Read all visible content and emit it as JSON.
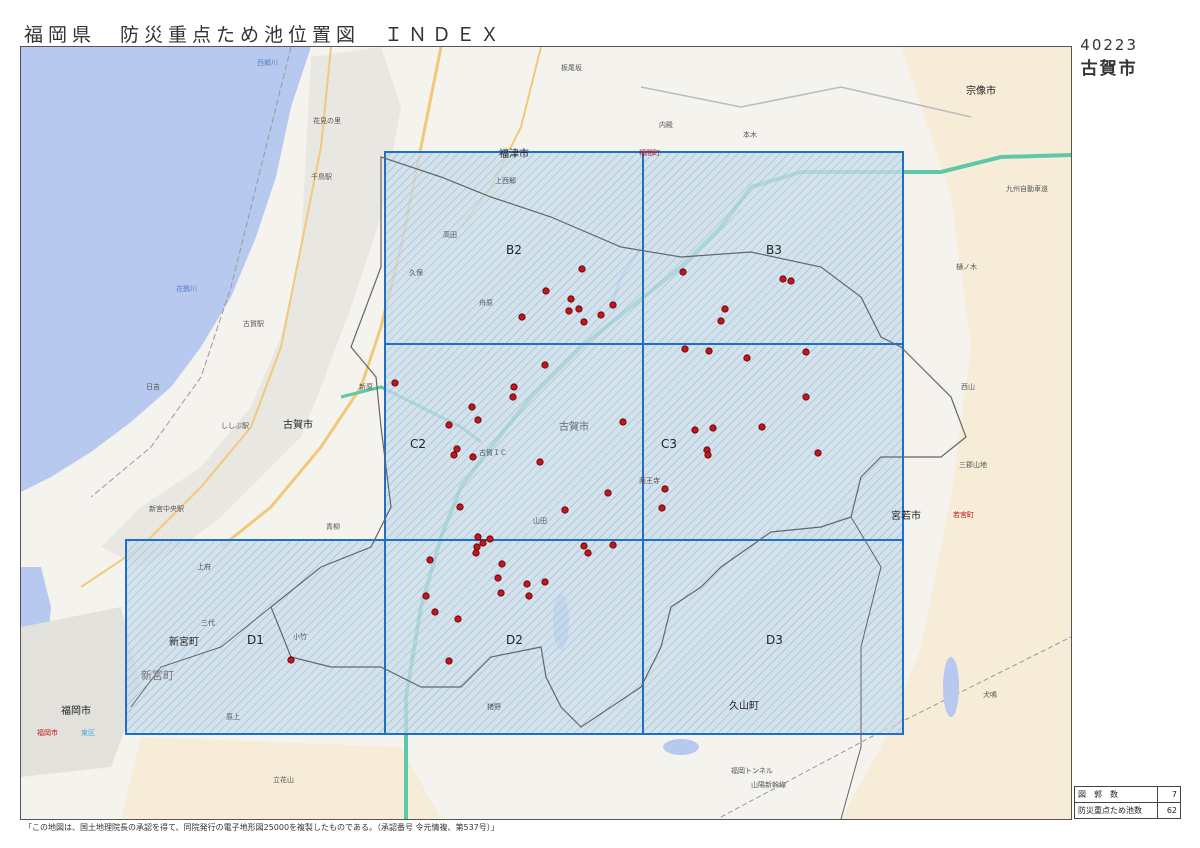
{
  "header": {
    "title": "福岡県　防災重点ため池位置図　ＩＮＤＥＸ",
    "code": "40223",
    "city": "古賀市"
  },
  "map": {
    "place_labels": [
      {
        "id": "fukutsu-city",
        "text": "福津市"
      },
      {
        "id": "koga-city-west",
        "text": "古賀市"
      },
      {
        "id": "koga-city-center",
        "text": "古賀市"
      },
      {
        "id": "miyawaka-city",
        "text": "宮若市"
      },
      {
        "id": "munakata-city",
        "text": "宗像市"
      },
      {
        "id": "shingu-town",
        "text": "新宮町"
      },
      {
        "id": "hisayama-town",
        "text": "久山町"
      },
      {
        "id": "fukuoka-city",
        "text": "福岡市"
      }
    ],
    "feature_labels": [
      {
        "id": "hananosato",
        "text": "花見の里"
      },
      {
        "id": "chidori-station",
        "text": "千鳥駅"
      },
      {
        "id": "koga-station",
        "text": "古賀駅"
      },
      {
        "id": "shishibu-station",
        "text": "ししぶ駅"
      },
      {
        "id": "shingu-chuo-station",
        "text": "新宮中央駅"
      },
      {
        "id": "koga-ic",
        "text": "古賀ＩＣ"
      },
      {
        "id": "kyushu-expressway",
        "text": "九州自動車道"
      },
      {
        "id": "hinoki",
        "text": "樋ノ木"
      },
      {
        "id": "nishiyama",
        "text": "西山"
      },
      {
        "id": "inukujira",
        "text": "犬鳴"
      },
      {
        "id": "tachibana",
        "text": "立花山"
      },
      {
        "id": "fukuoka-tunnel",
        "text": "福岡トンネル"
      },
      {
        "id": "sanyo-shinkansen",
        "text": "山陽新幹線"
      },
      {
        "id": "hibiki",
        "text": "日吉"
      },
      {
        "id": "shinbara",
        "text": "新原"
      },
      {
        "id": "aoyagi",
        "text": "青柳"
      },
      {
        "id": "itabashi",
        "text": "板尾坂"
      },
      {
        "id": "uchitono",
        "text": "内殿"
      },
      {
        "id": "motogi",
        "text": "本木"
      },
      {
        "id": "kubo",
        "text": "久保"
      },
      {
        "id": "takada",
        "text": "高田"
      },
      {
        "id": "kamiyoshida",
        "text": "上西郷"
      },
      {
        "id": "funabara",
        "text": "舟原"
      },
      {
        "id": "yakuoji",
        "text": "薬王寺"
      },
      {
        "id": "mitsuse",
        "text": "三郡山地"
      },
      {
        "id": "wakamiya",
        "text": "若宮町"
      },
      {
        "id": "fukutsu-red",
        "text": "福間町"
      },
      {
        "id": "fukuoka-red",
        "text": "福岡市"
      },
      {
        "id": "kasuya",
        "text": "東区"
      },
      {
        "id": "shingu-big",
        "text": "新宮町"
      },
      {
        "id": "mitoko",
        "text": "三代"
      },
      {
        "id": "kotake",
        "text": "小竹"
      },
      {
        "id": "higashi-kotake",
        "text": "上府"
      },
      {
        "id": "kamibaru",
        "text": "原上"
      },
      {
        "id": "yonekawa",
        "text": "猪野"
      },
      {
        "id": "yamada",
        "text": "山田"
      },
      {
        "id": "fukui-river",
        "text": "花鶴川"
      },
      {
        "id": "nishigo-river",
        "text": "西郷川"
      }
    ],
    "sheets": [
      {
        "id": "B2",
        "label": "B2"
      },
      {
        "id": "B3",
        "label": "B3"
      },
      {
        "id": "C2",
        "label": "C2"
      },
      {
        "id": "C3",
        "label": "C3"
      },
      {
        "id": "D1",
        "label": "D1"
      },
      {
        "id": "D2",
        "label": "D2"
      },
      {
        "id": "D3",
        "label": "D3"
      }
    ],
    "pond_count_displayed": 62,
    "colors": {
      "sea": "#b7c9ee",
      "sheet_fill": "#c9dcea",
      "sheet_border": "#1e6fc8",
      "pond": "#c0161c",
      "expressway": "#5fc7a8",
      "city_boundary": "#666666"
    }
  },
  "summary": {
    "rows": [
      {
        "label": "図　郭　数",
        "value": "7"
      },
      {
        "label": "防災重点ため池数",
        "value": "62"
      }
    ]
  },
  "footer": {
    "note": "「この地図は、国土地理院長の承認を得て、同院発行の電子地形図25000を複製したものである。（承認番号 令元情複、第537号）」"
  }
}
